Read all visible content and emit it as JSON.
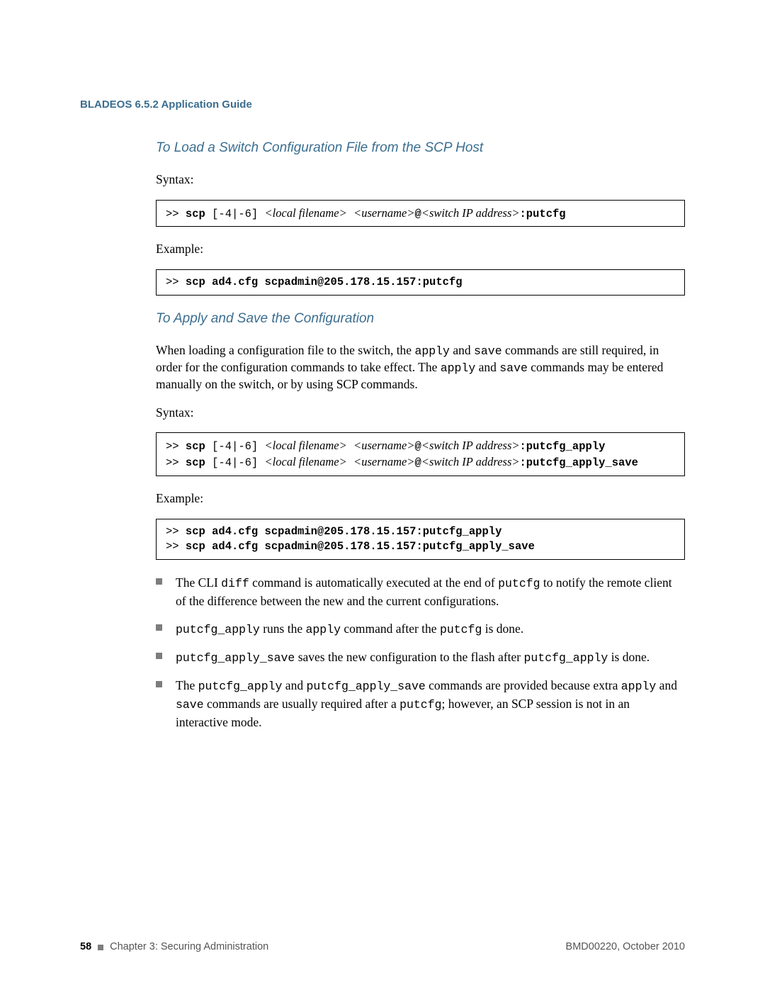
{
  "header": {
    "title": "BLADEOS 6.5.2 Application Guide"
  },
  "section1": {
    "heading": "To Load a Switch Configuration File from the SCP Host",
    "syntax_label": "Syntax:",
    "code_syntax_prefix": ">> ",
    "code_syntax_cmd1a": "scp ",
    "code_syntax_cmd1b": "[-4|-6] ",
    "code_syntax_par1": "<local filename>",
    "code_syntax_sp": "  ",
    "code_syntax_par2": "<username>",
    "code_syntax_at": "@",
    "code_syntax_par3": "<switch IP address>",
    "code_syntax_suffix": ":putcfg",
    "example_label": "Example:",
    "code_example_prefix": ">> ",
    "code_example_cmd": "scp ad4.cfg scpadmin@205.178.15.157:putcfg"
  },
  "section2": {
    "heading": "To Apply and Save the Configuration",
    "intro_a": "When loading a configuration file to the switch, the ",
    "intro_code1": "apply",
    "intro_b": " and ",
    "intro_code2": "save",
    "intro_c": " commands are still required, in order for the configuration commands to take effect. The ",
    "intro_code3": "apply",
    "intro_d": " and ",
    "intro_code4": "save",
    "intro_e": " commands may be entered manually on the switch, or by using SCP commands.",
    "syntax_label": "Syntax:",
    "code_syntax": {
      "line1": {
        "prefix": ">> ",
        "cmd1": "scp ",
        "flags": "[-4|-6] ",
        "p1": "<local filename>",
        "sp": "  ",
        "p2": "<username>",
        "at": "@",
        "p3": "<switch IP address>",
        "suffix": ":putcfg_apply"
      },
      "line2": {
        "prefix": ">> ",
        "cmd1": "scp ",
        "flags": "[-4|-6] ",
        "p1": "<local filename>",
        "sp": "  ",
        "p2": "<username>",
        "at": "@",
        "p3": "<switch IP address>",
        "suffix": ":putcfg_apply_save"
      }
    },
    "example_label": "Example:",
    "code_example": {
      "line1": {
        "prefix": ">> ",
        "cmd": "scp ad4.cfg scpadmin@205.178.15.157:putcfg_apply"
      },
      "line2": {
        "prefix": ">> ",
        "cmd": "scp ad4.cfg scpadmin@205.178.15.157:putcfg_apply_save"
      }
    },
    "bullets": {
      "b1_a": "The CLI ",
      "b1_code1": "diff",
      "b1_b": " command is automatically executed at the end of ",
      "b1_code2": "putcfg",
      "b1_c": " to notify the remote client of the difference between the new and the current configurations.",
      "b2_code1": "putcfg_apply",
      "b2_a": " runs the ",
      "b2_code2": "apply",
      "b2_b": " command after the ",
      "b2_code3": "putcfg",
      "b2_c": " is done.",
      "b3_code1": "putcfg_apply_save",
      "b3_a": " saves the new configuration to the flash after ",
      "b3_code2": "putcfg_apply",
      "b3_b": " is done.",
      "b4_a": "The ",
      "b4_code1": "putcfg_apply",
      "b4_b": " and ",
      "b4_code2": "putcfg_apply_save",
      "b4_c": " commands are provided because extra ",
      "b4_code3": "apply",
      "b4_d": " and ",
      "b4_code4": "save",
      "b4_e": " commands are usually required after a ",
      "b4_code5": "putcfg",
      "b4_f": "; however, an SCP session is not in an interactive mode."
    }
  },
  "footer": {
    "page_no": "58",
    "chapter": "Chapter 3: Securing Administration",
    "docid": "BMD00220, October 2010"
  }
}
